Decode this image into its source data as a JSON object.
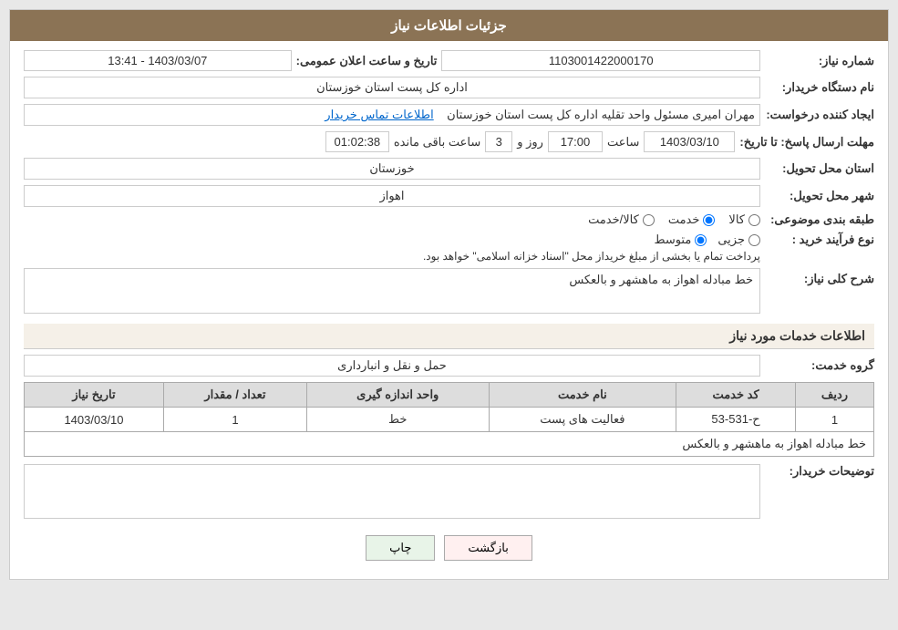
{
  "header": {
    "title": "جزئیات اطلاعات نیاز"
  },
  "fields": {
    "need_number_label": "شماره نیاز:",
    "need_number_value": "1103001422000170",
    "buyer_org_label": "نام دستگاه خریدار:",
    "buyer_org_value": "اداره کل پست استان خوزستان",
    "creator_label": "ایجاد کننده درخواست:",
    "creator_value": "مهران امیری مسئول واحد تقلیه اداره کل پست استان خوزستان",
    "creator_link": "اطلاعات تماس خریدار",
    "deadline_label": "مهلت ارسال پاسخ: تا تاریخ:",
    "deadline_date": "1403/03/10",
    "deadline_time_label": "ساعت",
    "deadline_time_value": "17:00",
    "deadline_days_label": "روز و",
    "deadline_days_value": "3",
    "deadline_remaining_label": "ساعت باقی مانده",
    "deadline_remaining_value": "01:02:38",
    "announce_label": "تاریخ و ساعت اعلان عمومی:",
    "announce_value": "1403/03/07 - 13:41",
    "province_label": "استان محل تحویل:",
    "province_value": "خوزستان",
    "city_label": "شهر محل تحویل:",
    "city_value": "اهواز",
    "category_label": "طبقه بندی موضوعی:",
    "category_options": [
      {
        "id": "kala",
        "label": "کالا"
      },
      {
        "id": "khedmat",
        "label": "خدمت"
      },
      {
        "id": "kala_khedmat",
        "label": "کالا/خدمت"
      }
    ],
    "category_selected": "khedmat",
    "proc_type_label": "نوع فرآیند خرید :",
    "proc_type_options": [
      {
        "id": "jazee",
        "label": "جزیی"
      },
      {
        "id": "motavaset",
        "label": "متوسط"
      },
      {
        "id": "other",
        "label": ""
      }
    ],
    "proc_type_selected": "motavaset",
    "proc_type_note": "پرداخت تمام یا بخشی از مبلغ خریداز محل \"اسناد خزانه اسلامی\" خواهد بود.",
    "general_desc_label": "شرح کلی نیاز:",
    "general_desc_value": "خط مبادله اهواز به ماهشهر و بالعکس"
  },
  "services_section": {
    "title": "اطلاعات خدمات مورد نیاز",
    "service_group_label": "گروه خدمت:",
    "service_group_value": "حمل و نقل و انبارداری",
    "table": {
      "headers": [
        "ردیف",
        "کد خدمت",
        "نام خدمت",
        "واحد اندازه گیری",
        "تعداد / مقدار",
        "تاریخ نیاز"
      ],
      "rows": [
        {
          "row_num": "1",
          "service_code": "ح-531-53",
          "service_name": "فعالیت های پست",
          "unit": "خط",
          "quantity": "1",
          "need_date": "1403/03/10"
        }
      ]
    },
    "row_desc": "خط مبادله اهواز به ماهشهر و بالعکس"
  },
  "buyer_desc": {
    "label": "توضیحات خریدار:",
    "value": ""
  },
  "buttons": {
    "print_label": "چاپ",
    "back_label": "بازگشت"
  }
}
